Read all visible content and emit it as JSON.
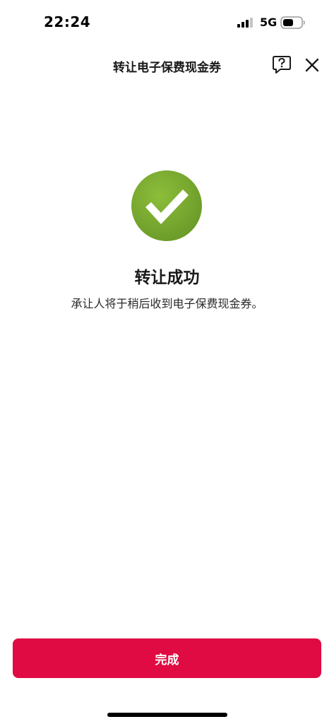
{
  "status_bar": {
    "time": "22:24",
    "network": "5G",
    "signal_icon": "cellular-signal-icon",
    "battery_icon": "battery-icon"
  },
  "header": {
    "title": "转让电子保费现金券",
    "help_icon": "help-question-icon",
    "close_icon": "close-icon"
  },
  "result": {
    "icon": "success-check-icon",
    "icon_color": "#7aab2f",
    "title": "转让成功",
    "message": "承让人将于稍后收到电子保费现金券。"
  },
  "actions": {
    "done_label": "完成",
    "done_color": "#e00b42"
  }
}
